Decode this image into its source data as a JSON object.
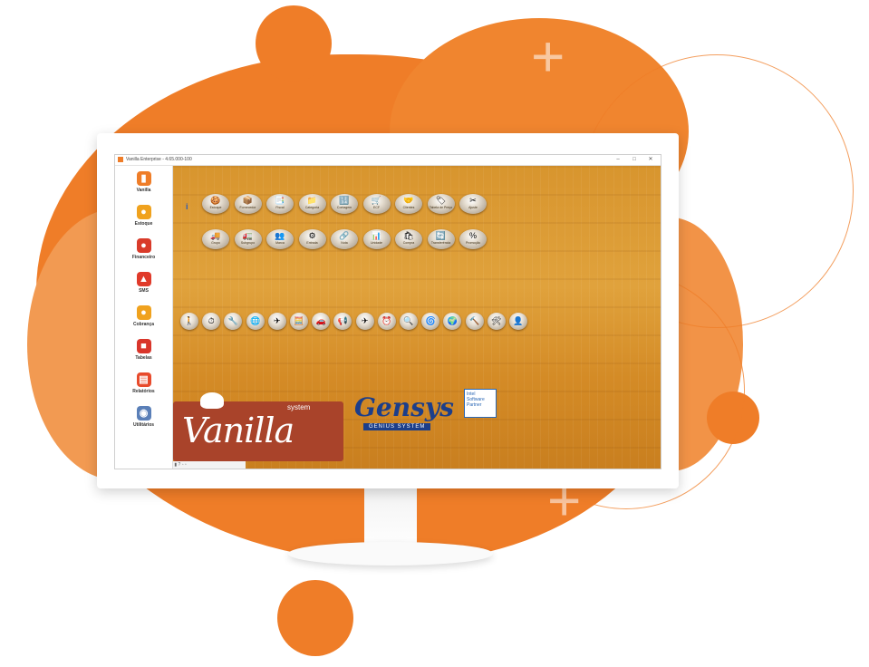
{
  "window": {
    "title": "Vanilla Enterprise - 4.65.000-100",
    "controls": [
      "–",
      "□",
      "✕"
    ]
  },
  "sidebar": {
    "items": [
      {
        "label": "Vanilla",
        "icon": "vanilla-icon",
        "glyph": "▮",
        "color": "#ef7d28"
      },
      {
        "label": "Estoque",
        "icon": "stock-icon",
        "glyph": "●",
        "color": "#f0a21e"
      },
      {
        "label": "Financeiro",
        "icon": "finance-icon",
        "glyph": "●",
        "color": "#d93b2a"
      },
      {
        "label": "SMS",
        "icon": "rocket-icon",
        "glyph": "▲",
        "color": "#e03a2a"
      },
      {
        "label": "Cobrança",
        "icon": "billing-icon",
        "glyph": "●",
        "color": "#f0a21e"
      },
      {
        "label": "Tabelas",
        "icon": "tables-icon",
        "glyph": "■",
        "color": "#d9362b"
      },
      {
        "label": "Relatórios",
        "icon": "reports-icon",
        "glyph": "▤",
        "color": "#e84b2c"
      },
      {
        "label": "Utilitários",
        "icon": "utilities-icon",
        "glyph": "◉",
        "color": "#5a7fb8"
      }
    ]
  },
  "toolbar_row1": [
    {
      "label": "Estoque",
      "glyph": "🍪"
    },
    {
      "label": "Fornecedor",
      "glyph": "📦"
    },
    {
      "label": "Fiscal",
      "glyph": "📑"
    },
    {
      "label": "Categoria",
      "glyph": "📁"
    },
    {
      "label": "Contagem",
      "glyph": "🔢"
    },
    {
      "label": "ECF",
      "glyph": "🛒"
    },
    {
      "label": "Clientes",
      "glyph": "🤝"
    },
    {
      "label": "Tabela de Preço",
      "glyph": "🏷"
    },
    {
      "label": "Ajuste",
      "glyph": "✂"
    }
  ],
  "toolbar_row2": [
    {
      "label": "Grupo",
      "glyph": "🚚"
    },
    {
      "label": "Subgrupo",
      "glyph": "🚛"
    },
    {
      "label": "Marca",
      "glyph": "👥"
    },
    {
      "label": "Entrada",
      "glyph": "⚙"
    },
    {
      "label": "Nota",
      "glyph": "🔗"
    },
    {
      "label": "Unidade",
      "glyph": "📊"
    },
    {
      "label": "Compra",
      "glyph": "🛍"
    },
    {
      "label": "Transferência",
      "glyph": "🔄"
    },
    {
      "label": "Promoção",
      "glyph": "%"
    }
  ],
  "toolbar_row3": [
    {
      "glyph": "🚶"
    },
    {
      "glyph": "⏱"
    },
    {
      "glyph": "🔧"
    },
    {
      "glyph": "🌐"
    },
    {
      "glyph": "✈"
    },
    {
      "glyph": "🧮"
    },
    {
      "glyph": "🚗"
    },
    {
      "glyph": "📢"
    },
    {
      "glyph": "✈"
    },
    {
      "glyph": "⏰"
    },
    {
      "glyph": "🔍"
    },
    {
      "glyph": "🌀"
    },
    {
      "glyph": "🌍"
    },
    {
      "glyph": "🔨"
    },
    {
      "glyph": "🛠"
    },
    {
      "glyph": "👤"
    }
  ],
  "logos": {
    "vanilla_word": "Vanilla",
    "vanilla_system": "system",
    "gensys_word": "Gensys",
    "gensys_tag": "GENIUS SYSTEM",
    "intel_text": "Intel Software Partner"
  },
  "colors": {
    "accent": "#ef7d28",
    "wood": "#d8952e"
  }
}
